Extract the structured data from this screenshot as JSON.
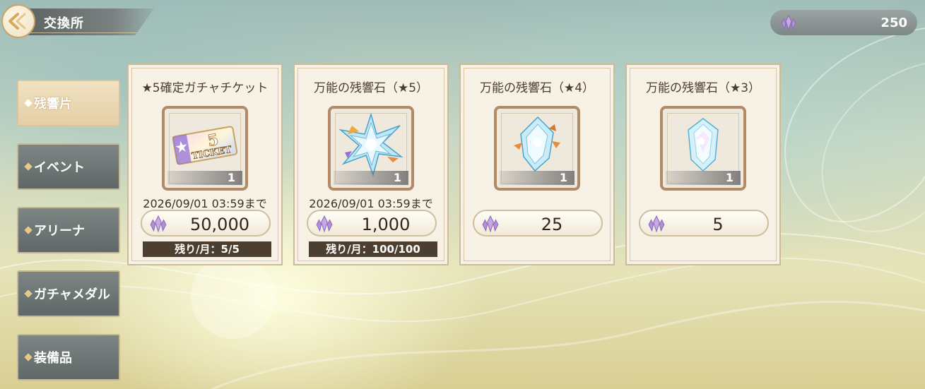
{
  "header": {
    "title": "交換所",
    "back_icon": "back-arrow-icon"
  },
  "currency": {
    "icon": "crystal-shard-icon",
    "amount": "250"
  },
  "sidebar": {
    "items": [
      {
        "label": "残響片",
        "active": true
      },
      {
        "label": "イベント",
        "active": false
      },
      {
        "label": "アリーナ",
        "active": false
      },
      {
        "label": "ガチャメダル",
        "active": false
      },
      {
        "label": "装備品",
        "active": false
      }
    ]
  },
  "shop": {
    "items": [
      {
        "name": "★5確定ガチャチケット",
        "icon": "star5-ticket-icon",
        "quantity": "1",
        "expiry": "2026/09/01 03:59まで",
        "price": "50,000",
        "remaining": "残り/月：5/5"
      },
      {
        "name": "万能の残響石（★5）",
        "icon": "crystal-star5-icon",
        "quantity": "1",
        "expiry": "2026/09/01 03:59まで",
        "price": "1,000",
        "remaining": "残り/月：100/100"
      },
      {
        "name": "万能の残響石（★4）",
        "icon": "crystal-star4-icon",
        "quantity": "1",
        "expiry": "",
        "price": "25",
        "remaining": ""
      },
      {
        "name": "万能の残響石（★3）",
        "icon": "crystal-star3-icon",
        "quantity": "1",
        "expiry": "",
        "price": "5",
        "remaining": ""
      }
    ]
  },
  "ticket_art": {
    "star_number": "5",
    "word": "TICKET"
  },
  "colors": {
    "accent_gold": "#c6a46a",
    "card_bg": "#f8f2e6",
    "remain_bg": "#4d3f30",
    "sidebar_btn": "#6b7472"
  }
}
